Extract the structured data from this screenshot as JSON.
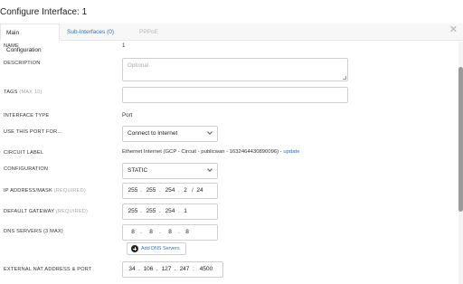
{
  "header": {
    "title": "Configure Interface: 1",
    "close_icon": "close-icon"
  },
  "tabs": [
    {
      "label": "Main Configuration",
      "active": true
    },
    {
      "label": "Sub-Interfaces (0)",
      "active": false
    },
    {
      "label": "PPPoE",
      "active": false,
      "disabled": true
    }
  ],
  "form": {
    "name": {
      "label": "NAME",
      "value": "1"
    },
    "description": {
      "label": "DESCRIPTION",
      "placeholder": "Optional"
    },
    "tags": {
      "label": "TAGS",
      "hint": "(MAX 10)",
      "value": ""
    },
    "interface_type": {
      "label": "INTERFACE TYPE",
      "value": "Port"
    },
    "use_port_for": {
      "label": "USE THIS PORT FOR...",
      "value": "Connect to Internet"
    },
    "circuit_label": {
      "label": "CIRCUIT LABEL",
      "value": "Ethernet Internet (GCP - Circuit - publicwan - 1632464430890096) - ",
      "link": "update"
    },
    "configuration": {
      "label": "CONFIGURATION",
      "value": "STATIC"
    },
    "ip_address": {
      "label": "IP ADDRESS/MASK",
      "hint": "(REQUIRED)",
      "octets": [
        "255",
        "255",
        "254",
        "2"
      ],
      "mask": "24"
    },
    "default_gateway": {
      "label": "DEFAULT GATEWAY",
      "hint": "(REQUIRED)",
      "octets": [
        "255",
        "255",
        "254",
        "1"
      ]
    },
    "dns_servers": {
      "label": "DNS SERVERS (3 MAX)",
      "octets": [
        "8",
        "8",
        "8",
        "8"
      ],
      "add_button": "Add DNS Servers"
    },
    "external_nat": {
      "label": "EXTERNAL NAT ADDRESS & PORT",
      "octets": [
        "34",
        "106",
        "127",
        "247"
      ],
      "port": "4500"
    }
  },
  "colors": {
    "accent": "#2f6fc6",
    "border": "#cfcfcf",
    "muted": "#aaaaaa"
  }
}
